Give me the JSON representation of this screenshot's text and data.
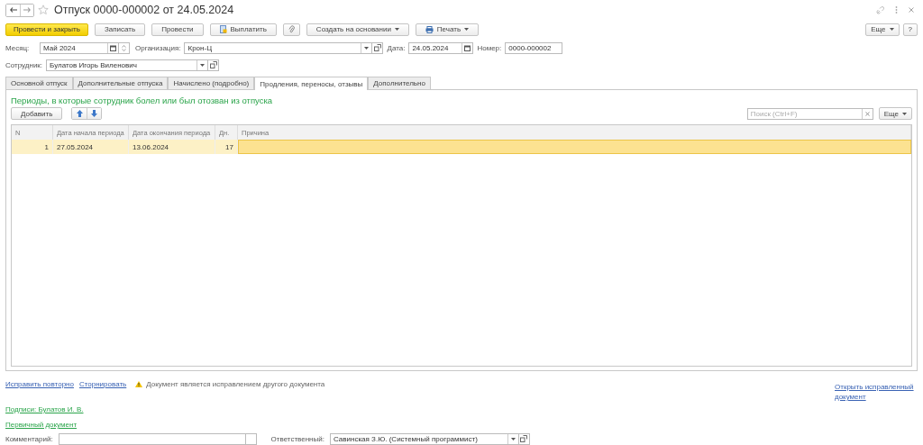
{
  "window": {
    "title": "Отпуск 0000-000002 от 24.05.2024",
    "favorite": false
  },
  "toolbar": {
    "buttons": [
      {
        "label": "Провести и закрыть",
        "kind": "primary"
      },
      {
        "label": "Записать",
        "kind": "plain"
      },
      {
        "label": "Провести",
        "kind": "plain"
      },
      {
        "label": "Выплатить",
        "kind": "pay"
      },
      {
        "kind": "attach"
      },
      {
        "label": "Создать на основании",
        "kind": "dropdown"
      },
      {
        "label": "Печать",
        "kind": "print"
      }
    ],
    "more": "Еще",
    "help": "?"
  },
  "header": {
    "month_label": "Месяц:",
    "month": "Май 2024",
    "organization_label": "Организация:",
    "organization": "Крон-Ц",
    "date_label": "Дата:",
    "date": "24.05.2024",
    "number_label": "Номер:",
    "number": "0000-000002",
    "employee_label": "Сотрудник:",
    "employee": "Булатов Игорь Виленович"
  },
  "tabs": [
    {
      "label": "Основной отпуск",
      "selected": false
    },
    {
      "label": "Дополнительные отпуска",
      "selected": false
    },
    {
      "label": "Начислено (подробно)",
      "selected": false
    },
    {
      "label": "Продления, переносы, отзывы",
      "selected": true
    },
    {
      "label": "Дополнительно",
      "selected": false
    }
  ],
  "section": {
    "heading": "Периоды, в которые сотрудник болел или был отозван из отпуска",
    "add_button": "Добавить",
    "search": {
      "placeholder": "Поиск (Ctrl+F)"
    },
    "more": "Еще"
  },
  "table": {
    "columns": [
      "N",
      "Дата начала периода",
      "Дата окончания периода",
      "Дн.",
      "Причина"
    ],
    "rows": [
      {
        "n": "1",
        "start": "27.05.2024",
        "end": "13.06.2024",
        "days": "17",
        "selected": true
      }
    ]
  },
  "footer": {
    "links": [
      "Исправить повторно",
      "Сторнировать"
    ],
    "warning": "Документ является исправлением другого документа",
    "open_link": "Открыть исправленный документ",
    "signatures": "Подписи: Булатов И. В.",
    "primary_doc": "Первичный документ",
    "comment_label": "Комментарий:",
    "responsible_label": "Ответственный:",
    "responsible": "Савинская З.Ю. (Системный программист)"
  }
}
